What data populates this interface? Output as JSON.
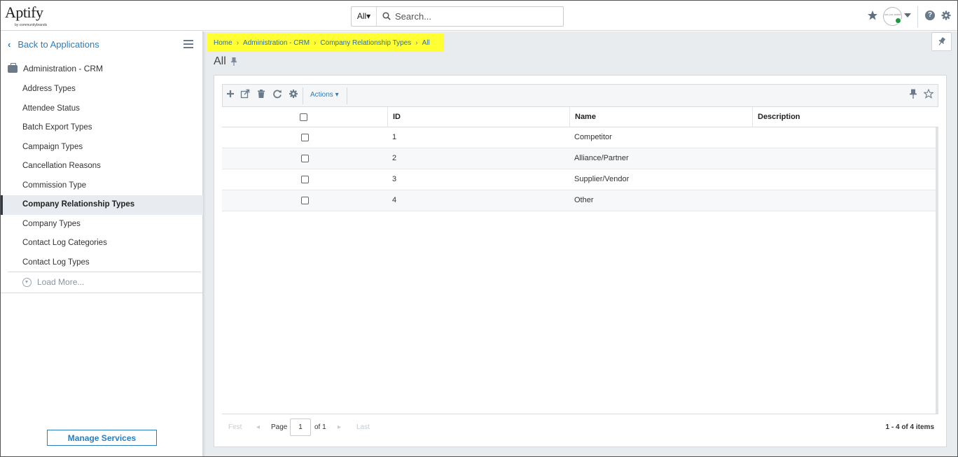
{
  "header": {
    "logo_text": "Aptify",
    "logo_sub": "by communitybrands",
    "search_scope": "All▾",
    "search_placeholder": "Search...",
    "avatar_text": "not pro-sided"
  },
  "sidebar": {
    "back_label": "Back to Applications",
    "section_title": "Administration - CRM",
    "items": [
      {
        "label": "Address Types"
      },
      {
        "label": "Attendee Status"
      },
      {
        "label": "Batch Export Types"
      },
      {
        "label": "Campaign Types"
      },
      {
        "label": "Cancellation Reasons"
      },
      {
        "label": "Commission Type"
      },
      {
        "label": "Company Relationship Types",
        "active": true
      },
      {
        "label": "Company Types"
      },
      {
        "label": "Contact Log Categories"
      },
      {
        "label": "Contact Log Types"
      }
    ],
    "load_more_label": "Load More...",
    "manage_services_label": "Manage Services"
  },
  "breadcrumb": {
    "items": [
      "Home",
      "Administration - CRM",
      "Company Relationship Types",
      "All"
    ],
    "highlight_color": "#ffff33"
  },
  "page": {
    "title": "All"
  },
  "toolbar": {
    "actions_label": "Actions ▾"
  },
  "grid": {
    "columns": [
      "ID",
      "Name",
      "Description"
    ],
    "rows": [
      {
        "id": "1",
        "name": "Competitor",
        "description": ""
      },
      {
        "id": "2",
        "name": "Alliance/Partner",
        "description": ""
      },
      {
        "id": "3",
        "name": "Supplier/Vendor",
        "description": ""
      },
      {
        "id": "4",
        "name": "Other",
        "description": ""
      }
    ]
  },
  "pager": {
    "first_label": "First",
    "page_label": "Page",
    "page_value": "1",
    "of_label": "of 1",
    "last_label": "Last",
    "items_label": "1 - 4 of 4 items"
  },
  "colors": {
    "accent": "#2a7dbf",
    "status_online": "#1a9a3a"
  }
}
